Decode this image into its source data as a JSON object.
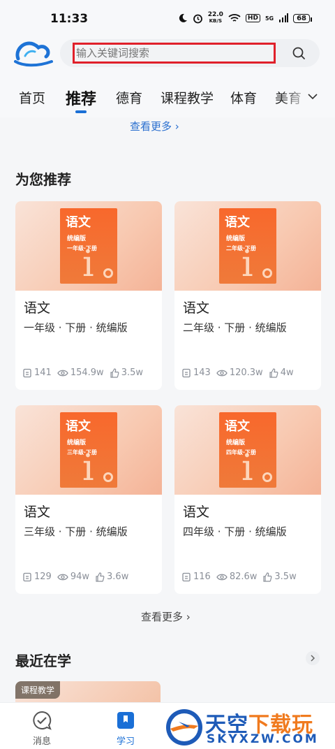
{
  "status_bar": {
    "time": "11:33",
    "net_speed": "22.0",
    "net_unit": "KB/S",
    "hd": "HD",
    "signal": "5G",
    "battery": "68"
  },
  "search": {
    "placeholder": "输入关键词搜索"
  },
  "tabs": [
    {
      "label": "首页",
      "active": false
    },
    {
      "label": "推荐",
      "active": true
    },
    {
      "label": "德育",
      "active": false
    },
    {
      "label": "课程教学",
      "active": false
    },
    {
      "label": "体育",
      "active": false
    },
    {
      "label": "美育",
      "active": false
    }
  ],
  "see_more_top": "查看更多 ›",
  "recommend": {
    "title": "为您推荐",
    "cards": [
      {
        "book_title": "语文",
        "book_edition": "统编版",
        "book_grade": "一年级·下册",
        "name": "语文",
        "sub": "一年级 · 下册 · 统编版",
        "lessons": "141",
        "views": "154.9w",
        "likes": "3.5w"
      },
      {
        "book_title": "语文",
        "book_edition": "统编版",
        "book_grade": "二年级·下册",
        "name": "语文",
        "sub": "二年级 · 下册 · 统编版",
        "lessons": "143",
        "views": "120.3w",
        "likes": "4w"
      },
      {
        "book_title": "语文",
        "book_edition": "统编版",
        "book_grade": "三年级·下册",
        "name": "语文",
        "sub": "三年级 · 下册 · 统编版",
        "lessons": "129",
        "views": "94w",
        "likes": "3.6w"
      },
      {
        "book_title": "语文",
        "book_edition": "统编版",
        "book_grade": "四年级·下册",
        "name": "语文",
        "sub": "四年级 · 下册 · 统编版",
        "lessons": "116",
        "views": "82.6w",
        "likes": "3.5w"
      }
    ],
    "book_letter": "i"
  },
  "see_more_bottom": "查看更多 ›",
  "recent": {
    "title": "最近在学",
    "tag": "课程教学"
  },
  "bottom_nav": [
    {
      "label": "消息",
      "icon": "chat-check-icon",
      "active": false
    },
    {
      "label": "学习",
      "icon": "book-icon",
      "active": true
    }
  ],
  "watermark": {
    "brand_blue": "天空",
    "brand_orange": "下载玩",
    "domain": "SKYXZW.COM"
  },
  "colors": {
    "accent": "#1a6fd6",
    "search_highlight": "#e0202a",
    "book_orange": "#f8682c"
  }
}
